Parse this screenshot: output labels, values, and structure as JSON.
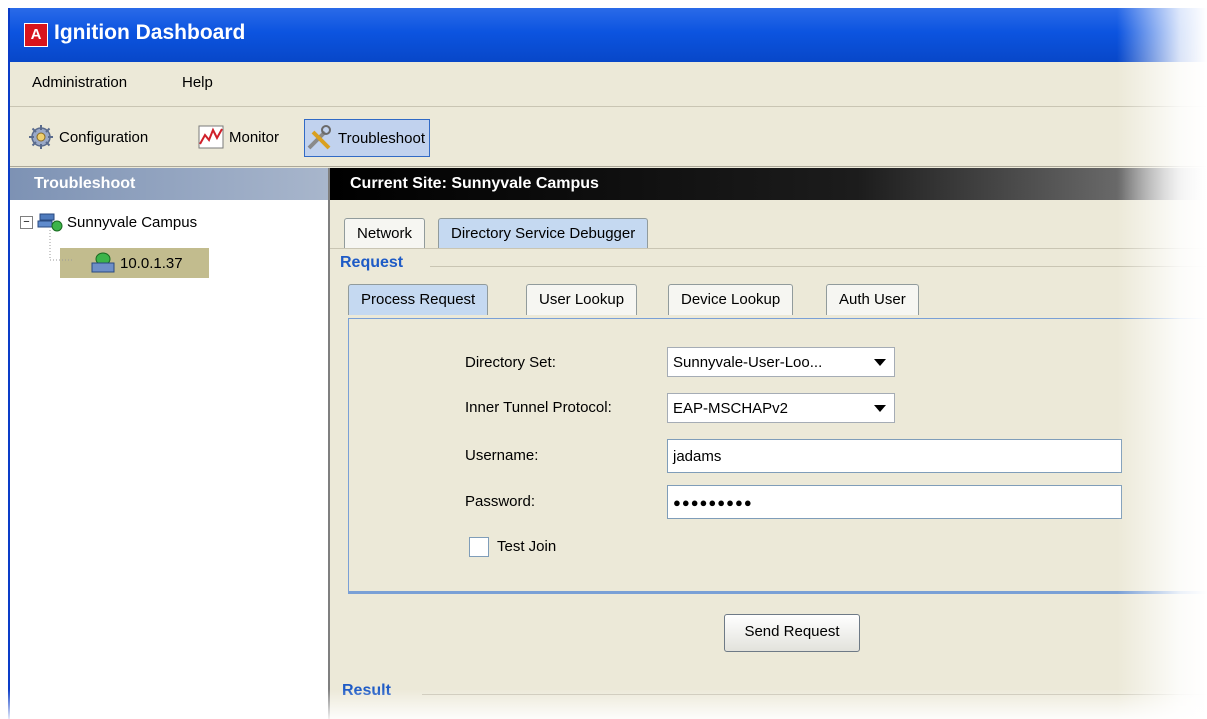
{
  "window": {
    "title": "Ignition Dashboard",
    "logo_letter": "A"
  },
  "menubar": {
    "items": [
      {
        "label": "Administration"
      },
      {
        "label": "Help"
      }
    ]
  },
  "toolbar": {
    "items": [
      {
        "label": "Configuration",
        "icon": "gear-icon"
      },
      {
        "label": "Monitor",
        "icon": "chart-icon"
      },
      {
        "label": "Troubleshoot",
        "icon": "tools-icon",
        "selected": true
      }
    ]
  },
  "sidebar": {
    "header": "Troubleshoot",
    "tree": [
      {
        "label": "Sunnyvale Campus",
        "icon": "network-icon",
        "expand_symbol": "−"
      },
      {
        "label": "10.0.1.37",
        "icon": "server-icon",
        "selected": true
      }
    ]
  },
  "main": {
    "site_header": "Current Site:  Sunnyvale Campus",
    "tabs": [
      {
        "label": "Network"
      },
      {
        "label": "Directory Service Debugger",
        "active": true
      }
    ],
    "request_section": "Request",
    "sub_tabs": [
      {
        "label": "Process Request",
        "active": true
      },
      {
        "label": "User Lookup"
      },
      {
        "label": "Device Lookup"
      },
      {
        "label": "Auth User"
      }
    ],
    "form": {
      "directory_set_label": "Directory Set:",
      "directory_set_value": "Sunnyvale-User-Loo...",
      "protocol_label": "Inner Tunnel Protocol:",
      "protocol_value": "EAP-MSCHAPv2",
      "username_label": "Username:",
      "username_value": "jadams",
      "password_label": "Password:",
      "password_value": "●●●●●●●●●",
      "test_join_label": "Test Join",
      "test_join_checked": false
    },
    "send_button": "Send Request",
    "result_section": "Result"
  },
  "colors": {
    "title_blue": "#0c54e0",
    "section_blue": "#1e5bc6",
    "tab_active": "#c5d9f1",
    "selected_node": "#c2bc8e"
  }
}
